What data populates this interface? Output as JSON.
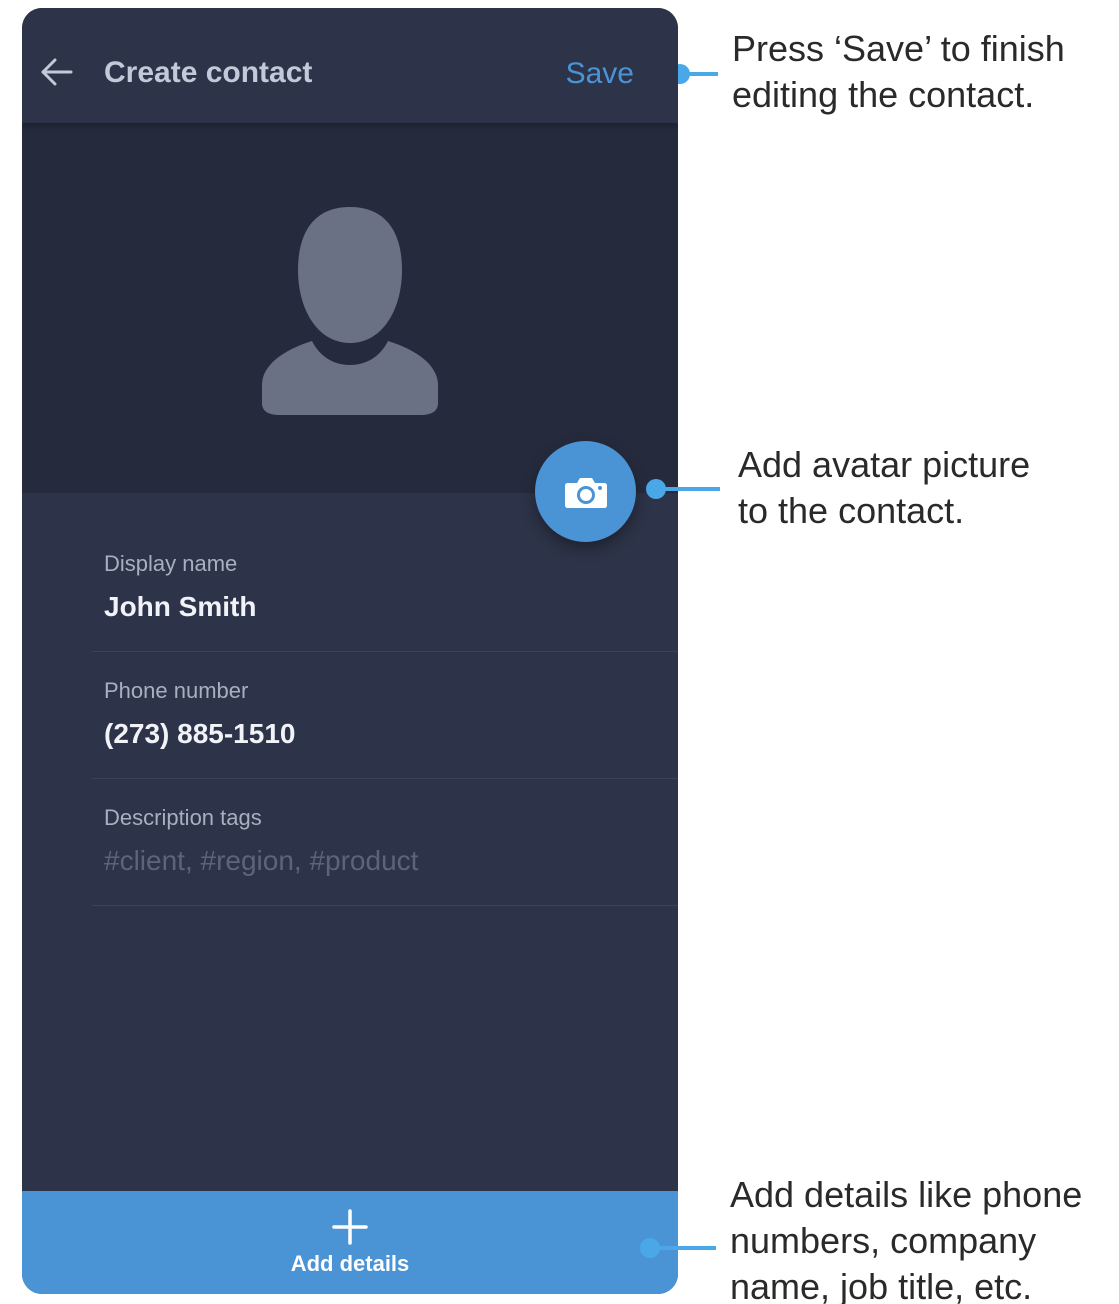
{
  "app_bar": {
    "back_icon": "arrow-left-icon",
    "title": "Create contact",
    "save_label": "Save"
  },
  "avatar": {
    "placeholder_icon": "person-silhouette-icon",
    "camera_icon": "camera-icon"
  },
  "form": {
    "display_name": {
      "label": "Display name",
      "value": "John Smith"
    },
    "phone_number": {
      "label": "Phone number",
      "value": "(273) 885-1510"
    },
    "description_tags": {
      "label": "Description tags",
      "placeholder": "#client, #region, #product"
    }
  },
  "bottom_bar": {
    "icon": "plus-icon",
    "label": "Add details"
  },
  "annotations": {
    "save": "Press ‘Save’ to finish editing the contact.",
    "save_line1": "Press ‘Save’ to finish",
    "save_line2": "editing the contact.",
    "avatar_line1": "Add avatar picture",
    "avatar_line2": "to the contact.",
    "details_line1": "Add details like phone",
    "details_line2": "numbers, company",
    "details_line3": "name, job title, etc."
  },
  "colors": {
    "background_panel": "#2d3348",
    "avatar_area": "#252b3d",
    "accent": "#4a94d6",
    "silhouette": "#6b7184",
    "text_primary": "#f1f3f8",
    "text_secondary": "#a7afc2",
    "placeholder": "#5c6479",
    "annotation_text": "#2a2a2a",
    "connector": "#4aa8e8"
  }
}
